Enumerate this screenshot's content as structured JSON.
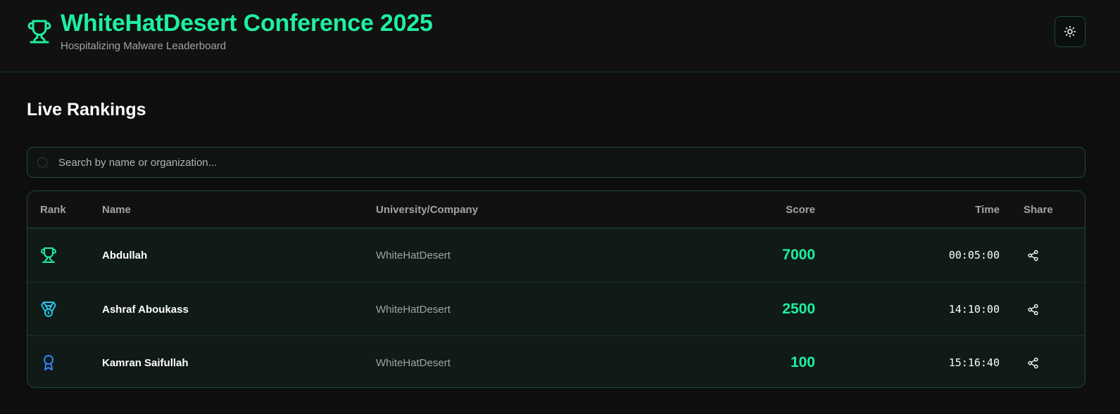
{
  "header": {
    "title": "WhiteHatDesert Conference 2025",
    "subtitle": "Hospitalizing Malware Leaderboard",
    "logo_icon": "trophy-icon",
    "theme_toggle_icon": "sun-icon",
    "accent_color": "#1ef0a0"
  },
  "main": {
    "section_title": "Live Rankings",
    "search": {
      "placeholder": "Search by name or organization...",
      "value": "",
      "icon": "search-icon"
    },
    "table": {
      "columns": {
        "rank": "Rank",
        "name": "Name",
        "org": "University/Company",
        "score": "Score",
        "time": "Time",
        "share": "Share"
      },
      "rows": [
        {
          "rank_icon": "trophy-icon",
          "rank_color": "#1ef0a0",
          "name": "Abdullah",
          "org": "WhiteHatDesert",
          "score": "7000",
          "time": "00:05:00",
          "share_icon": "share-icon"
        },
        {
          "rank_icon": "medal-icon",
          "rank_color": "#22c4e6",
          "name": "Ashraf Aboukass",
          "org": "WhiteHatDesert",
          "score": "2500",
          "time": "14:10:00",
          "share_icon": "share-icon"
        },
        {
          "rank_icon": "award-icon",
          "rank_color": "#3b82f6",
          "name": "Kamran Saifullah",
          "org": "WhiteHatDesert",
          "score": "100",
          "time": "15:16:40",
          "share_icon": "share-icon"
        }
      ]
    }
  }
}
